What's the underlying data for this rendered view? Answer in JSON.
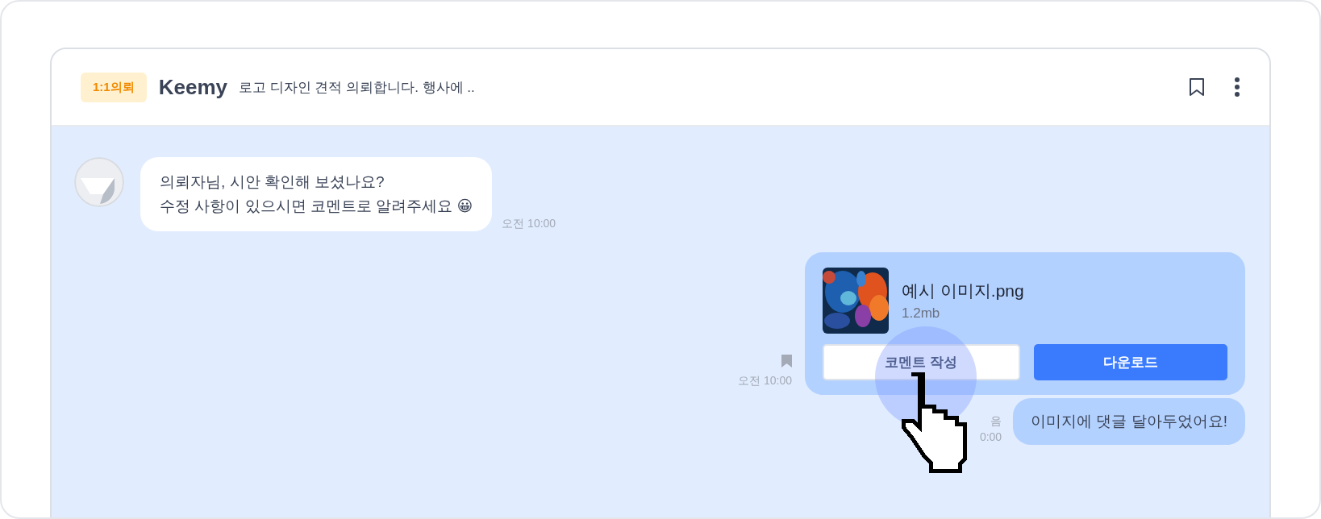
{
  "header": {
    "badge": "1:1의뢰",
    "name": "Keemy",
    "subject": "로고 디자인 견적 의뢰합니다. 행사에 .."
  },
  "messages": [
    {
      "kind": "incoming",
      "text": "의뢰자님, 시안 확인해 보셨나요?\n수정 사항이 있으시면 코멘트로 알려주세요 😀",
      "time": "오전 10:00"
    },
    {
      "kind": "file",
      "file_name": "예시 이미지.png",
      "file_size": "1.2mb",
      "bookmarked": true,
      "time": "오전 10:00",
      "buttons": [
        {
          "label": "코멘트 작성",
          "kind": "secondary"
        },
        {
          "label": "다운로드",
          "kind": "primary"
        }
      ]
    },
    {
      "kind": "outgoing",
      "text": "이미지에 댓글 달아두었어요!",
      "status": "음",
      "time": "0:00"
    }
  ]
}
